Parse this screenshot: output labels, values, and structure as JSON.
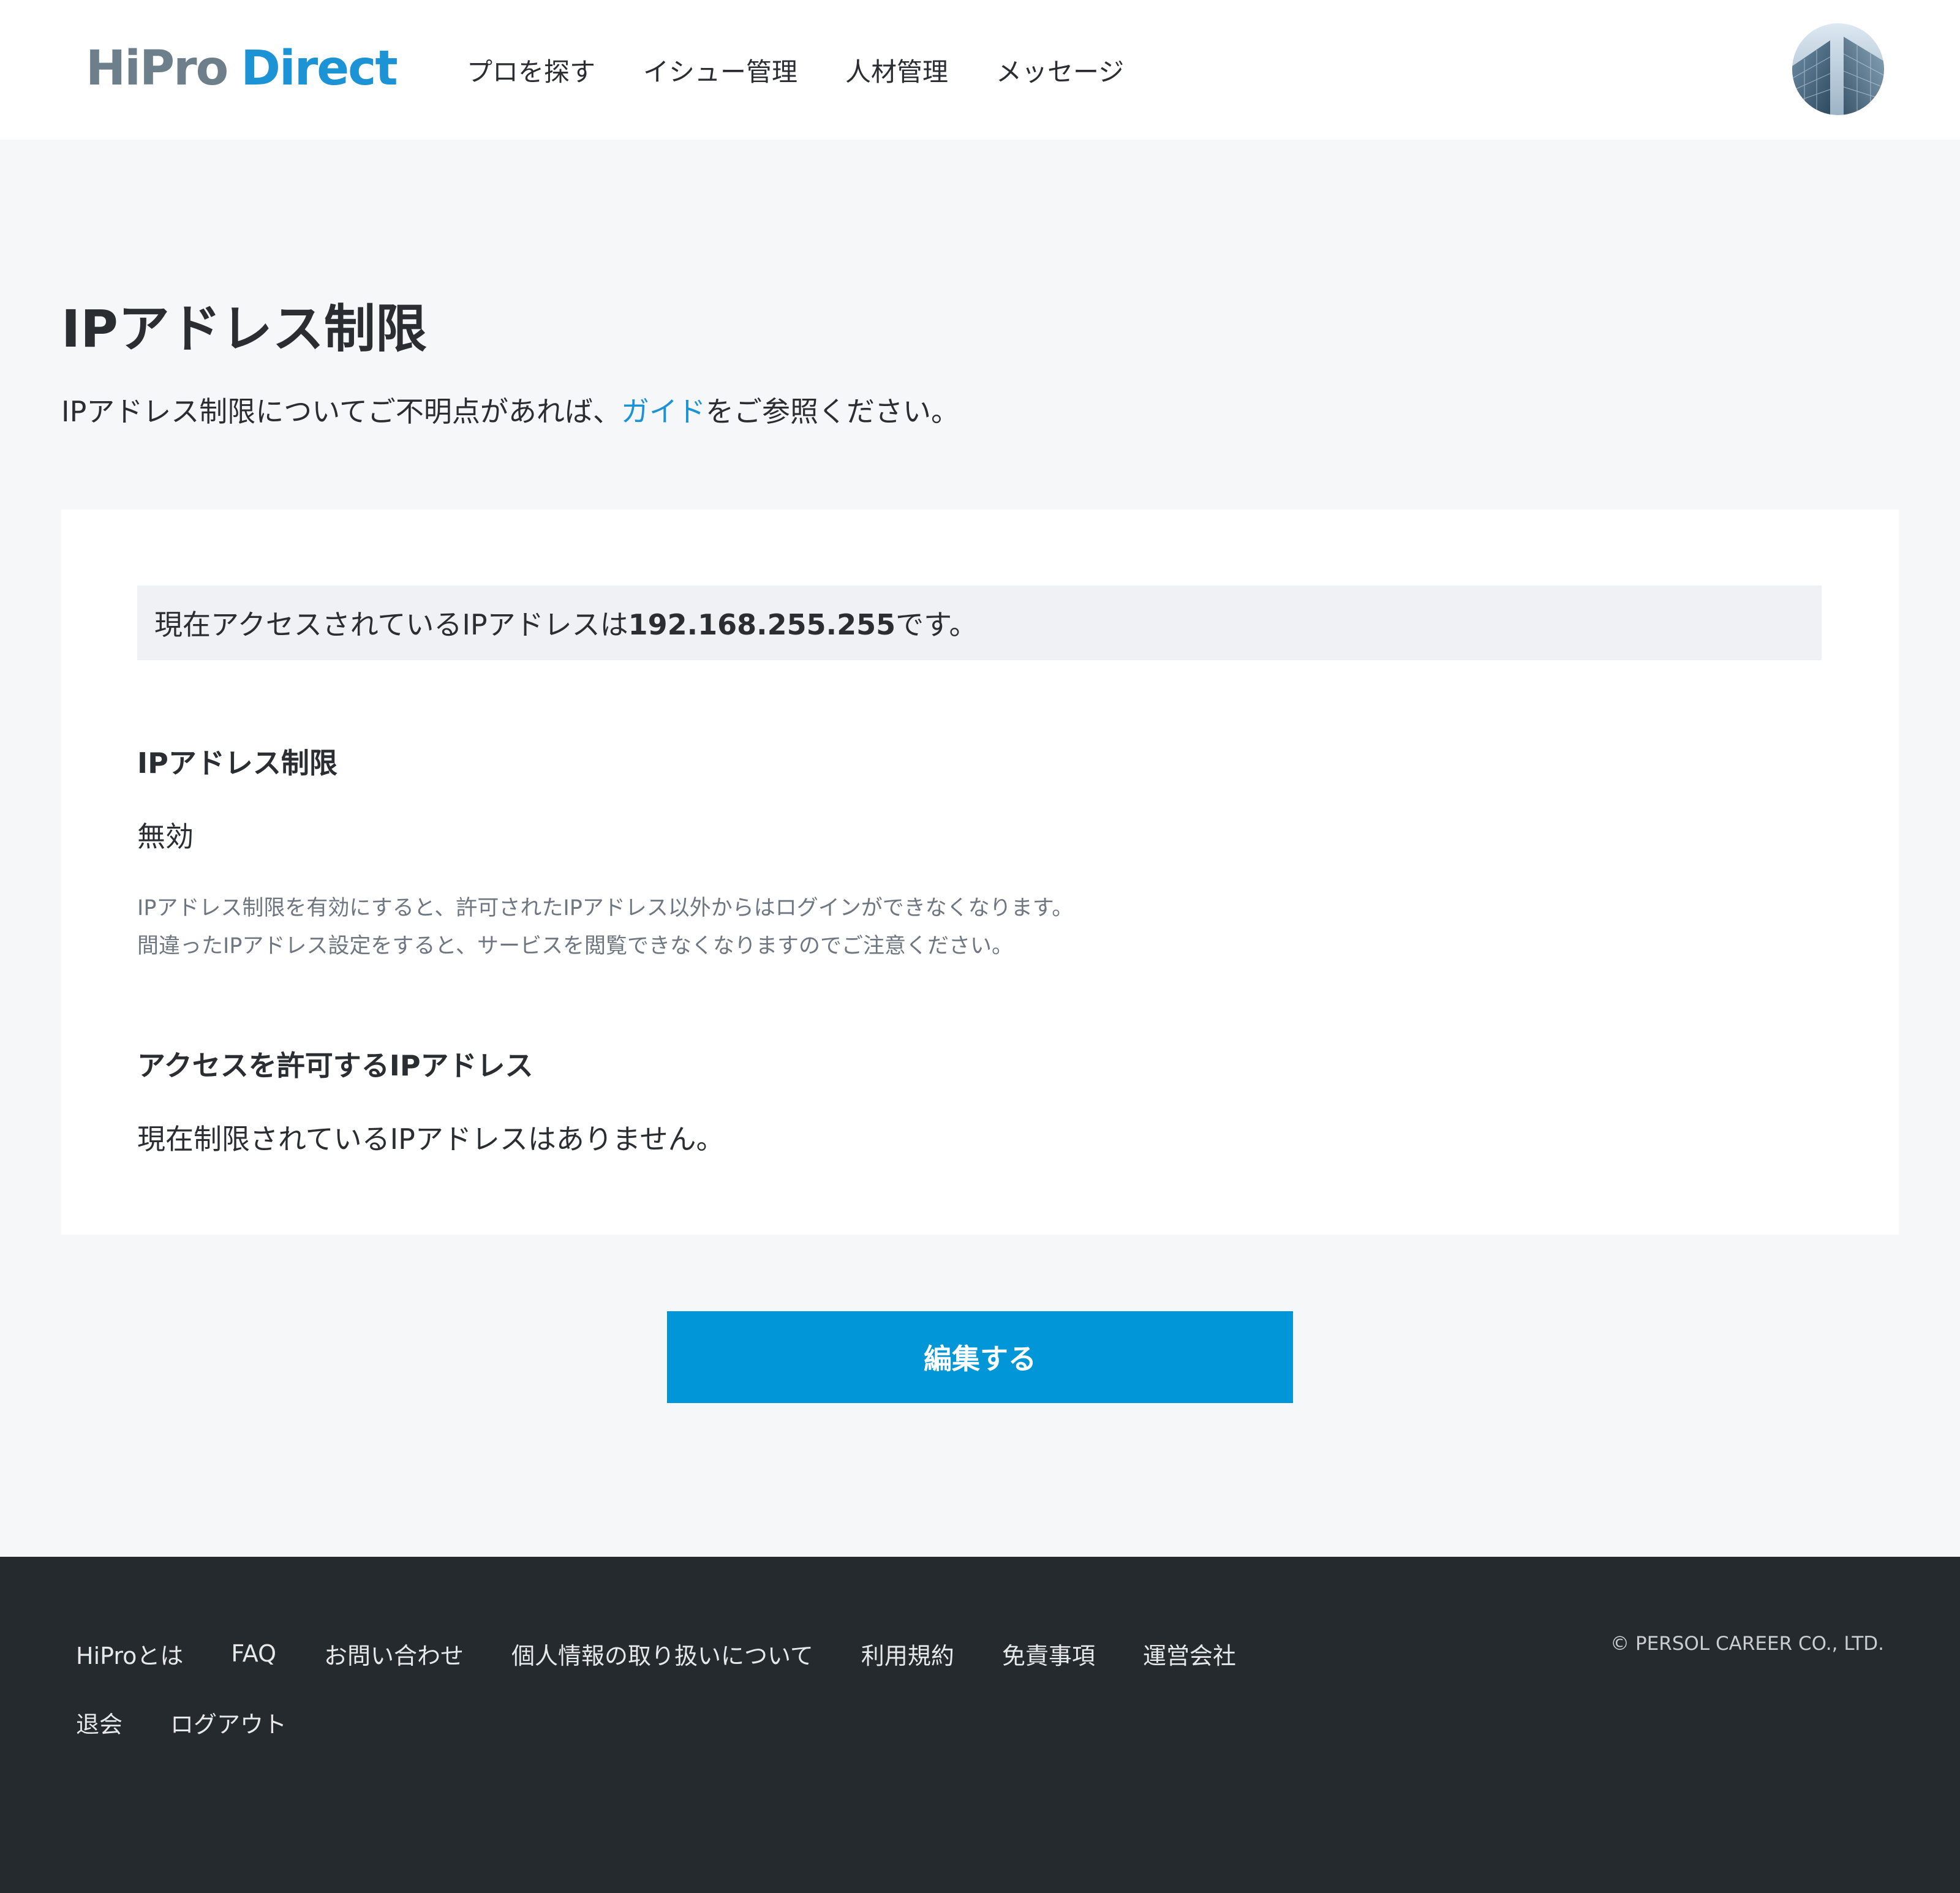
{
  "header": {
    "logo_part1": "HiPro",
    "logo_part2": "Direct",
    "nav": [
      {
        "label": "プロを探す"
      },
      {
        "label": "イシュー管理"
      },
      {
        "label": "人材管理"
      },
      {
        "label": "メッセージ"
      }
    ]
  },
  "page": {
    "title": "IPアドレス制限",
    "desc_before": "IPアドレス制限についてご不明点があれば、",
    "desc_link": "ガイド",
    "desc_after": "をご参照ください。"
  },
  "card": {
    "banner_before": "現在アクセスされているIPアドレスは",
    "banner_ip": "192.168.255.255",
    "banner_after": "です。",
    "restriction_heading": "IPアドレス制限",
    "restriction_status": "無効",
    "note_line1": "IPアドレス制限を有効にすると、許可されたIPアドレス以外からはログインができなくなります。",
    "note_line2": "間違ったIPアドレス設定をすると、サービスを閲覧できなくなりますのでご注意ください。",
    "allowed_heading": "アクセスを許可するIPアドレス",
    "allowed_value": "現在制限されているIPアドレスはありません。"
  },
  "actions": {
    "edit_label": "編集する"
  },
  "footer": {
    "row1": [
      {
        "label": "HiProとは"
      },
      {
        "label": "FAQ"
      },
      {
        "label": "お問い合わせ"
      },
      {
        "label": "個人情報の取り扱いについて"
      },
      {
        "label": "利用規約"
      },
      {
        "label": "免責事項"
      },
      {
        "label": "運営会社"
      }
    ],
    "row2": [
      {
        "label": "退会"
      },
      {
        "label": "ログアウト"
      }
    ],
    "copyright": "© PERSOL CAREER CO., LTD."
  },
  "colors": {
    "brand_blue": "#1c93d5",
    "button_blue": "#0196d8",
    "logo_gray": "#6e7f8c",
    "footer_bg": "#252a2e"
  }
}
